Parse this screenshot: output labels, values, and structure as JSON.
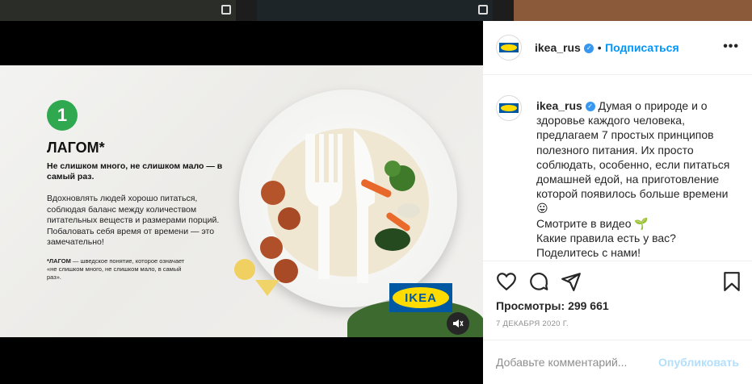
{
  "post": {
    "slide": {
      "badge": "1",
      "title": "ЛАГОМ*",
      "subtitle": "Не слишком много, не слишком мало — в самый раз.",
      "body": "Вдохновлять людей хорошо питаться, соблюдая баланс между количеством питательных веществ и размерами порций. Побаловать себя время от времени — это замечательно!",
      "note_term": "*ЛАГОМ",
      "note_text": " — шведское понятие, которое означает «не слишком много, не слишком мало, в самый раз».",
      "logo_text": "IKEA"
    }
  },
  "header": {
    "username": "ikea_rus",
    "separator": "•",
    "follow_label": "Подписаться",
    "more_label": "•••"
  },
  "caption": {
    "username": "ikea_rus",
    "line1": "Думая о природе и о здоровье каждого человека, предлагаем 7 простых принципов полезного питания. Их просто соблюдать, особенно, если питаться домашней едой, на приготовление которой появилось больше времени",
    "emoji1": "😛",
    "line2": "Смотрите в видео",
    "emoji2": "🌱",
    "line3": "Какие правила есть у вас?",
    "line4": "Поделитесь с нами!"
  },
  "stats": {
    "views_label": "Просмотры:",
    "views_value": "299 661",
    "date": "7 ДЕКАБРЯ 2020 Г."
  },
  "comment": {
    "placeholder": "Добавьте комментарий...",
    "publish_label": "Опубликовать"
  },
  "colors": {
    "accent": "#0095f6",
    "badge_green": "#2fa84f",
    "ikea_blue": "#0058a3",
    "ikea_yellow": "#ffdb00"
  }
}
